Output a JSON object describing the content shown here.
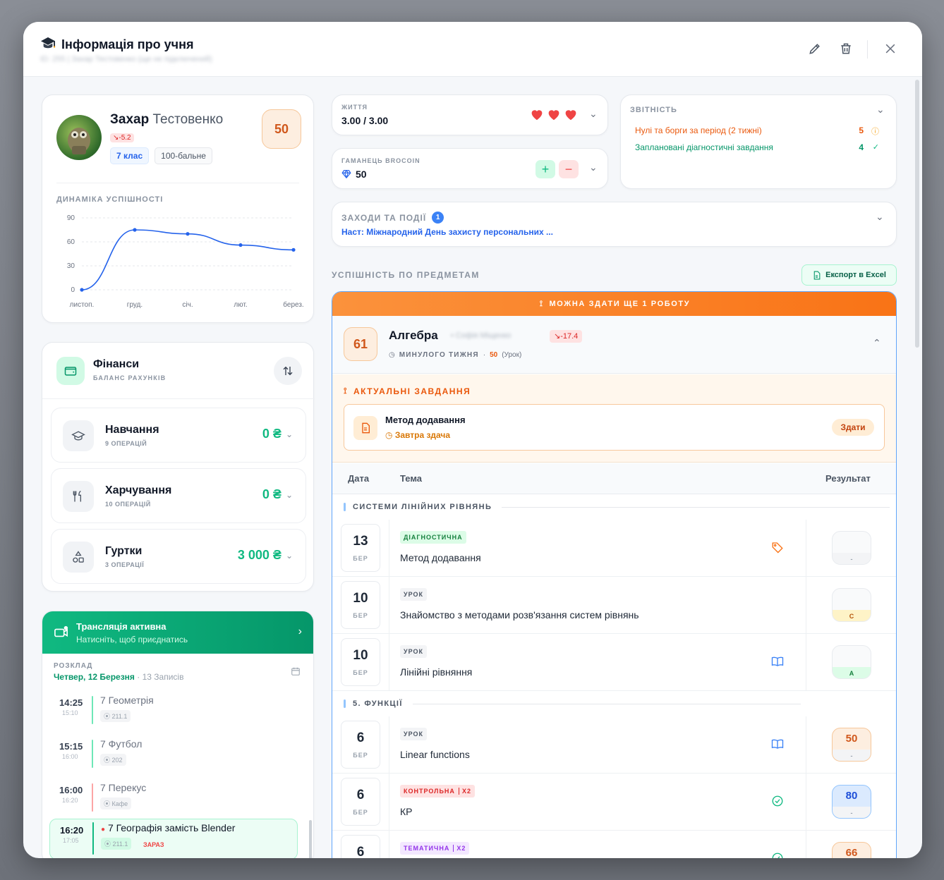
{
  "modal": {
    "title": "Інформація про учня",
    "title_icon": "graduation-cap-icon",
    "subtitle": "ID: 255 | Захар Тестовенко (ще не підключений)"
  },
  "student": {
    "first_name": "Захар",
    "last_name": "Тестовенко",
    "trend": "-5.2",
    "grade_label": "7 клас",
    "scale_label": "100-бальне",
    "score": "50"
  },
  "dynamics": {
    "title": "Динаміка успішності",
    "chart_data": {
      "type": "line",
      "categories": [
        "листоп.",
        "груд.",
        "січ.",
        "лют.",
        "берез."
      ],
      "x": [
        0,
        1,
        2,
        3,
        4,
        5
      ],
      "values": [
        0,
        75,
        70,
        56,
        50
      ],
      "yticks": [
        0,
        30,
        60,
        90
      ],
      "ylim": [
        0,
        90
      ],
      "grid": "dashed-horizontal",
      "color": "#2563eb"
    }
  },
  "finance": {
    "title": "Фінанси",
    "subtitle": "Баланс рахунків",
    "items": [
      {
        "name": "Навчання",
        "ops": "9 ОПЕРАЦІЙ",
        "value": "0 ₴",
        "icon": "graduation-cap-icon"
      },
      {
        "name": "Харчування",
        "ops": "10 ОПЕРАЦІЙ",
        "value": "0 ₴",
        "icon": "utensils-icon"
      },
      {
        "name": "Гуртки",
        "ops": "3 ОПЕРАЦІЇ",
        "value": "3 000 ₴",
        "icon": "shapes-icon"
      }
    ]
  },
  "stream": {
    "title": "Трансляція активна",
    "subtitle": "Натисніть, щоб приєднатись"
  },
  "schedule": {
    "label": "Розклад",
    "date": "Четвер, 12 Березня",
    "count": "· 13 Записів",
    "items": [
      {
        "time": "14:25",
        "end": "15:10",
        "name": "7 Геометрія",
        "room": "211.1",
        "bar": "#34d399"
      },
      {
        "time": "15:15",
        "end": "16:00",
        "name": "7 Футбол",
        "room": "202",
        "bar": "#34d399"
      },
      {
        "time": "16:00",
        "end": "16:20",
        "name": "7 Перекус",
        "room": "Кафе",
        "bar": "#f87171"
      },
      {
        "time": "16:20",
        "end": "17:05",
        "name": "7 Географія замість Blender",
        "room": "211.1",
        "now": "ЗАРАЗ",
        "bar": "#10b981"
      }
    ]
  },
  "life": {
    "label": "Життя",
    "value": "3.00 / 3.00",
    "hearts": 3
  },
  "wallet": {
    "label": "Гаманець BroCoin",
    "value": "50"
  },
  "report": {
    "label": "Звітність",
    "items": [
      {
        "text": "Нулі та борги за період (2 тижні)",
        "count": "5",
        "color": "#ea580c"
      },
      {
        "text": "Заплановані діагностичні завдання",
        "count": "4",
        "color": "#059669"
      }
    ]
  },
  "events": {
    "label": "Заходи та події",
    "badge": "1",
    "next": "Наст: Міжнародний День захисту персональних ..."
  },
  "subjects": {
    "label": "Успішність по предметам",
    "export_label": "Експорт в Excel",
    "banner": "Можна здати ще 1 роботу",
    "subject": {
      "score": "61",
      "name": "Алгебра",
      "teacher": "Софія Міщенко",
      "trend": "-17.4",
      "period": "Минулого тижня",
      "last_score": "50",
      "last_type": "(Урок)"
    },
    "actual_label": "Актуальні завдання",
    "task": {
      "title": "Метод додавання",
      "due": "Завтра здача",
      "button": "Здати"
    },
    "columns": {
      "date": "Дата",
      "topic": "Тема",
      "result": "Результат"
    },
    "sections": [
      {
        "title": "Системи лінійних рівнянь",
        "rows": [
          {
            "day": "13",
            "month": "БЕР",
            "tag": "ДІАГНОСТИЧНА",
            "topic": "Метод додавання",
            "icon": "tag-icon",
            "result": "",
            "grade": "-"
          },
          {
            "day": "10",
            "month": "БЕР",
            "tag": "УРОК",
            "topic": "Знайомство з методами розв'язання систем рівнянь",
            "icon": "",
            "result": "",
            "grade": "C"
          },
          {
            "day": "10",
            "month": "БЕР",
            "tag": "УРОК",
            "topic": "Лінійні рівняння",
            "icon": "book-icon",
            "result": "",
            "grade": "A"
          }
        ]
      },
      {
        "title": "5. Функції",
        "rows": [
          {
            "day": "6",
            "month": "БЕР",
            "tag": "УРОК",
            "topic": "Linear functions",
            "icon": "book-icon",
            "result": "50",
            "grade": "-"
          },
          {
            "day": "6",
            "month": "БЕР",
            "tag": "КОНТРОЛЬНА",
            "mult": "X2",
            "topic": "КР",
            "icon": "check-circle-icon",
            "result": "80",
            "grade": "-"
          },
          {
            "day": "6",
            "month": "БЕР",
            "tag": "ТЕМАТИЧНА",
            "mult": "X2",
            "topic": "",
            "icon": "check-circle-icon",
            "result": "66",
            "grade": ""
          }
        ]
      }
    ]
  }
}
